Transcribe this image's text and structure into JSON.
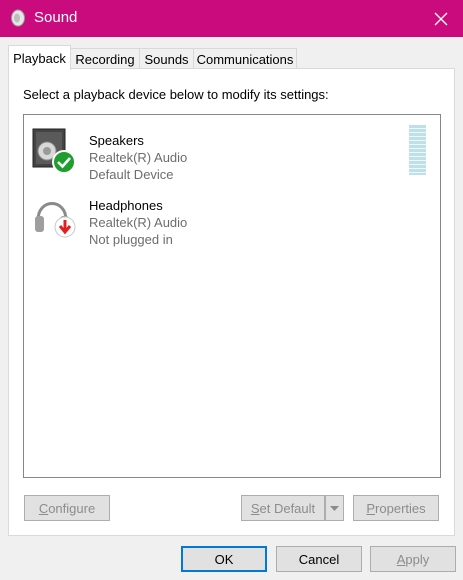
{
  "window": {
    "title": "Sound",
    "title_icon": "speaker-icon",
    "close_icon": "close-icon"
  },
  "tabs": [
    {
      "label": "Playback",
      "active": true
    },
    {
      "label": "Recording",
      "active": false
    },
    {
      "label": "Sounds",
      "active": false
    },
    {
      "label": "Communications",
      "active": false
    }
  ],
  "playback": {
    "instruction": "Select a playback device below to modify its settings:",
    "devices": [
      {
        "name": "Speakers",
        "driver": "Realtek(R) Audio",
        "status": "Default Device",
        "icon": "speakers-icon",
        "badge": "default-check-icon",
        "badge_color": "#1e9e2e"
      },
      {
        "name": "Headphones",
        "driver": "Realtek(R) Audio",
        "status": "Not plugged in",
        "icon": "headphones-icon",
        "badge": "unplugged-arrow-icon",
        "badge_color": "#e02020"
      }
    ]
  },
  "panel_buttons": {
    "configure": {
      "first": "C",
      "rest": "onfigure"
    },
    "set_default": {
      "first": "S",
      "rest": "et Default"
    },
    "properties": {
      "first": "P",
      "rest": "roperties"
    }
  },
  "dialog_buttons": {
    "ok": "OK",
    "cancel": "Cancel",
    "apply": {
      "first": "A",
      "rest": "pply"
    }
  },
  "colors": {
    "titlebar": "#c90b7d",
    "accent": "#0078d7"
  }
}
